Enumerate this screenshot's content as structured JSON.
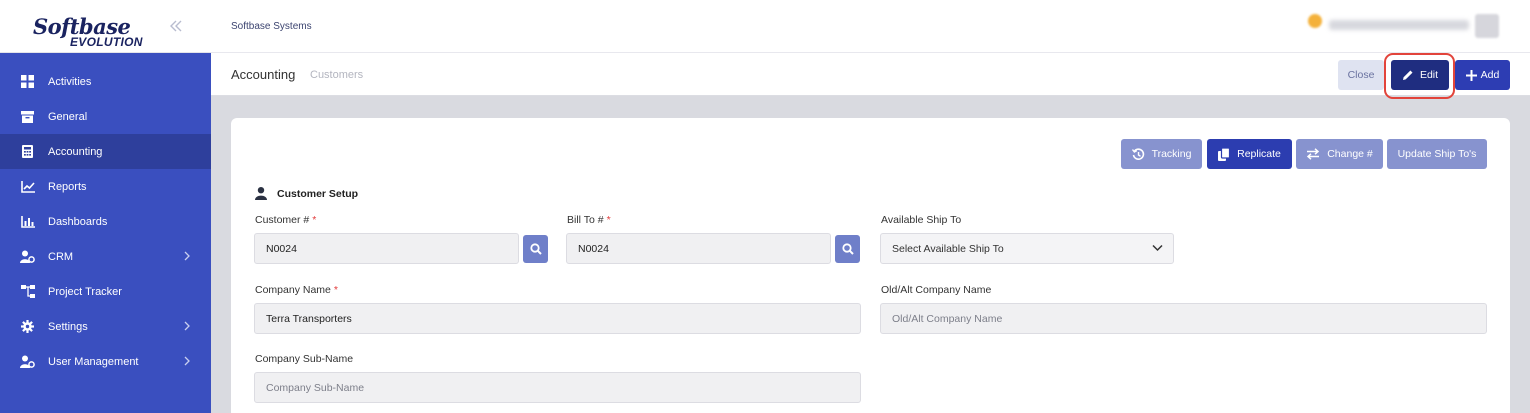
{
  "logo": {
    "top": "Softbase",
    "bottom": "EVOLUTION"
  },
  "sidebar": {
    "items": [
      {
        "label": "Activities",
        "icon": "grid-icon"
      },
      {
        "label": "General",
        "icon": "archive-icon"
      },
      {
        "label": "Accounting",
        "icon": "calculator-icon",
        "active": true
      },
      {
        "label": "Reports",
        "icon": "chart-line-icon"
      },
      {
        "label": "Dashboards",
        "icon": "bar-chart-icon"
      },
      {
        "label": "CRM",
        "icon": "users-cog-icon",
        "expandable": true
      },
      {
        "label": "Project Tracker",
        "icon": "sitemap-icon"
      },
      {
        "label": "Settings",
        "icon": "gear-icon",
        "expandable": true
      },
      {
        "label": "User Management",
        "icon": "user-cog-icon",
        "expandable": true
      }
    ]
  },
  "header": {
    "company": "Softbase Systems"
  },
  "breadcrumb": {
    "main": "Accounting",
    "sub": "Customers"
  },
  "toolbar": {
    "close_label": "Close",
    "edit_label": "Edit",
    "add_label": "Add"
  },
  "actions": {
    "tracking_label": "Tracking",
    "replicate_label": "Replicate",
    "change_label": "Change #",
    "update_label": "Update Ship To's"
  },
  "form": {
    "section_title": "Customer Setup",
    "customer_number": {
      "label": "Customer #",
      "value": "N0024",
      "required": "*"
    },
    "bill_to": {
      "label": "Bill To #",
      "value": "N0024",
      "required": "*"
    },
    "available_ship_to": {
      "label": "Available Ship To",
      "value": "Select Available Ship To"
    },
    "company_name": {
      "label": "Company Name",
      "value": "Terra Transporters",
      "required": "*"
    },
    "old_company_name": {
      "label": "Old/Alt Company Name",
      "placeholder": "Old/Alt Company Name"
    },
    "company_sub_name": {
      "label": "Company Sub-Name",
      "placeholder": "Company Sub-Name"
    }
  },
  "colors": {
    "sidebar": "#3a4fbf",
    "sidebar_active": "#2e3f9c",
    "primary": "#2c3db0",
    "edit": "#1f2d80",
    "muted_button": "#8793cf",
    "highlight": "#e2443b",
    "required": "#e23b3b"
  }
}
